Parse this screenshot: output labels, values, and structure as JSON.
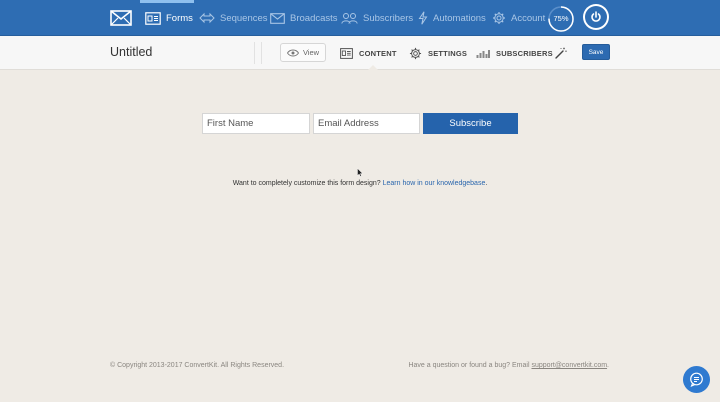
{
  "topnav": {
    "items": [
      {
        "label": "Forms",
        "icon": "form-icon",
        "active": true
      },
      {
        "label": "Sequences",
        "icon": "sequences-icon",
        "active": false
      },
      {
        "label": "Broadcasts",
        "icon": "envelope-icon",
        "active": false
      },
      {
        "label": "Subscribers",
        "icon": "users-icon",
        "active": false
      },
      {
        "label": "Automations",
        "icon": "lightning-icon",
        "active": false
      },
      {
        "label": "Account",
        "icon": "gear-icon",
        "active": false
      }
    ],
    "progress_label": "75%",
    "progress_value": 0.75,
    "colors": {
      "bar": "#2e6db3",
      "active_text": "#ffffff",
      "inactive_text": "#a9c6e6"
    }
  },
  "subheader": {
    "title": "Untitled",
    "view_label": "View",
    "tabs": [
      {
        "label": "CONTENT",
        "icon": "content-icon"
      },
      {
        "label": "SETTINGS",
        "icon": "gear-icon"
      },
      {
        "label": "SUBSCRIBERS",
        "icon": "bar-chart-icon"
      }
    ],
    "save_label": "Save"
  },
  "form": {
    "first_name_placeholder": "First Name",
    "email_placeholder": "Email Address",
    "subscribe_label": "Subscribe",
    "button_color": "#2563ac"
  },
  "help": {
    "text": "Want to completely customize this form design?",
    "link_text": "Learn how in our knowledgebase",
    "suffix": "."
  },
  "footer": {
    "copyright": "© Copyright 2013-2017 ConvertKit. All Rights Reserved.",
    "question": "Have a question or found a bug? Email",
    "email": "support@convertkit.com",
    "suffix": "."
  }
}
